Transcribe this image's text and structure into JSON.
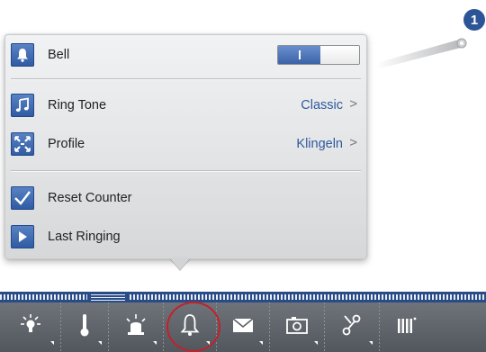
{
  "callout": {
    "number": "1"
  },
  "popup": {
    "bell": {
      "label": "Bell",
      "toggle_state": "on"
    },
    "ring_tone": {
      "label": "Ring Tone",
      "value": "Classic",
      "chevron": ">"
    },
    "profile": {
      "label": "Profile",
      "value": "Klingeln",
      "chevron": ">"
    },
    "reset_counter": {
      "label": "Reset Counter"
    },
    "last_ringing": {
      "label": "Last Ringing"
    }
  },
  "toolbar": {
    "items": [
      {
        "icon": "light-bulb-icon"
      },
      {
        "icon": "thermometer-icon"
      },
      {
        "icon": "siren-alarm-icon"
      },
      {
        "icon": "bell-icon",
        "highlighted": true
      },
      {
        "icon": "envelope-icon"
      },
      {
        "icon": "camera-icon"
      },
      {
        "icon": "scissors-tools-icon"
      },
      {
        "icon": "radiator-icon"
      }
    ]
  },
  "colors": {
    "accent_blue": "#2b5597",
    "value_text": "#2f5a9c",
    "highlight_ring": "#c4202a",
    "toolbar_bg": "#5f636a"
  }
}
